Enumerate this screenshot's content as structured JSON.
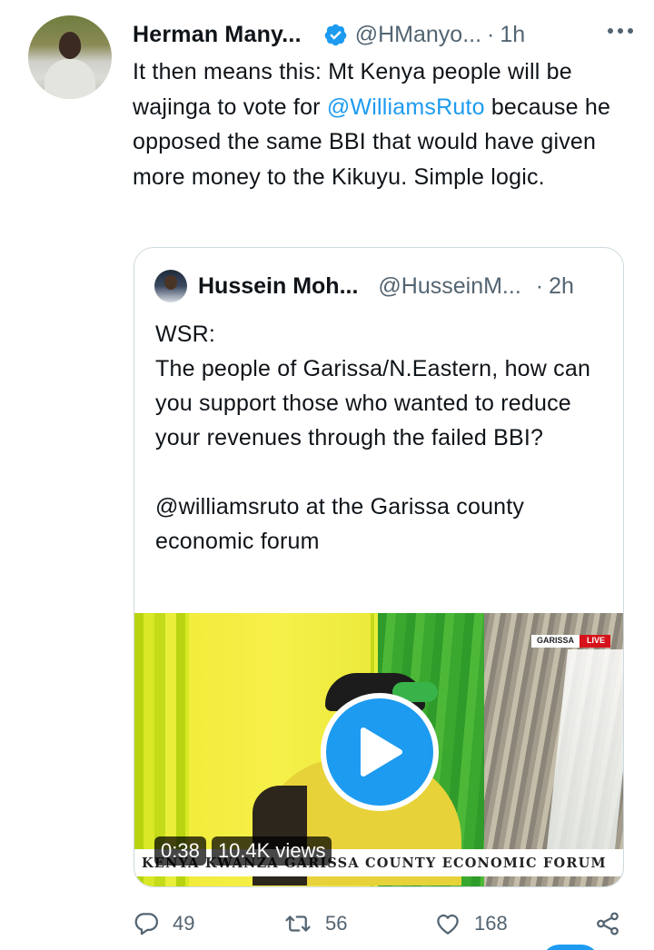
{
  "tweet": {
    "author_name": "Herman Many...",
    "handle": "@HManyo...",
    "separator": "·",
    "time": "1h",
    "text_before": "It then means this: Mt Kenya people will be wajinga to vote for ",
    "mention": "@WilliamsRuto",
    "text_after": " because he opposed the same BBI that would have given more money to the Kikuyu. Simple logic."
  },
  "quoted_tweet": {
    "author_name": "Hussein Moh...",
    "handle": "@HusseinM...",
    "separator": "·",
    "time": "2h",
    "lines": [
      "WSR:",
      "The people of Garissa/N.Eastern, how can you support those who wanted to reduce your revenues through the failed BBI?",
      "",
      "@williamsruto at the Garissa county economic forum"
    ],
    "video": {
      "duration": "0:38",
      "views": "10.4K views",
      "overlay_location": "GARISSA",
      "overlay_live": "LIVE",
      "overlay_caption": "KENYA KWANZA GARISSA COUNTY ECONOMIC FORUM"
    }
  },
  "actions": {
    "replies": "49",
    "retweets": "56",
    "likes": "168"
  },
  "colors": {
    "accent": "#1d9bf0",
    "secondary_text": "#536471",
    "border": "#cfd9de"
  },
  "icons": [
    "verified-badge-icon",
    "more-icon",
    "play-icon",
    "reply-icon",
    "retweet-icon",
    "like-icon",
    "share-icon"
  ]
}
